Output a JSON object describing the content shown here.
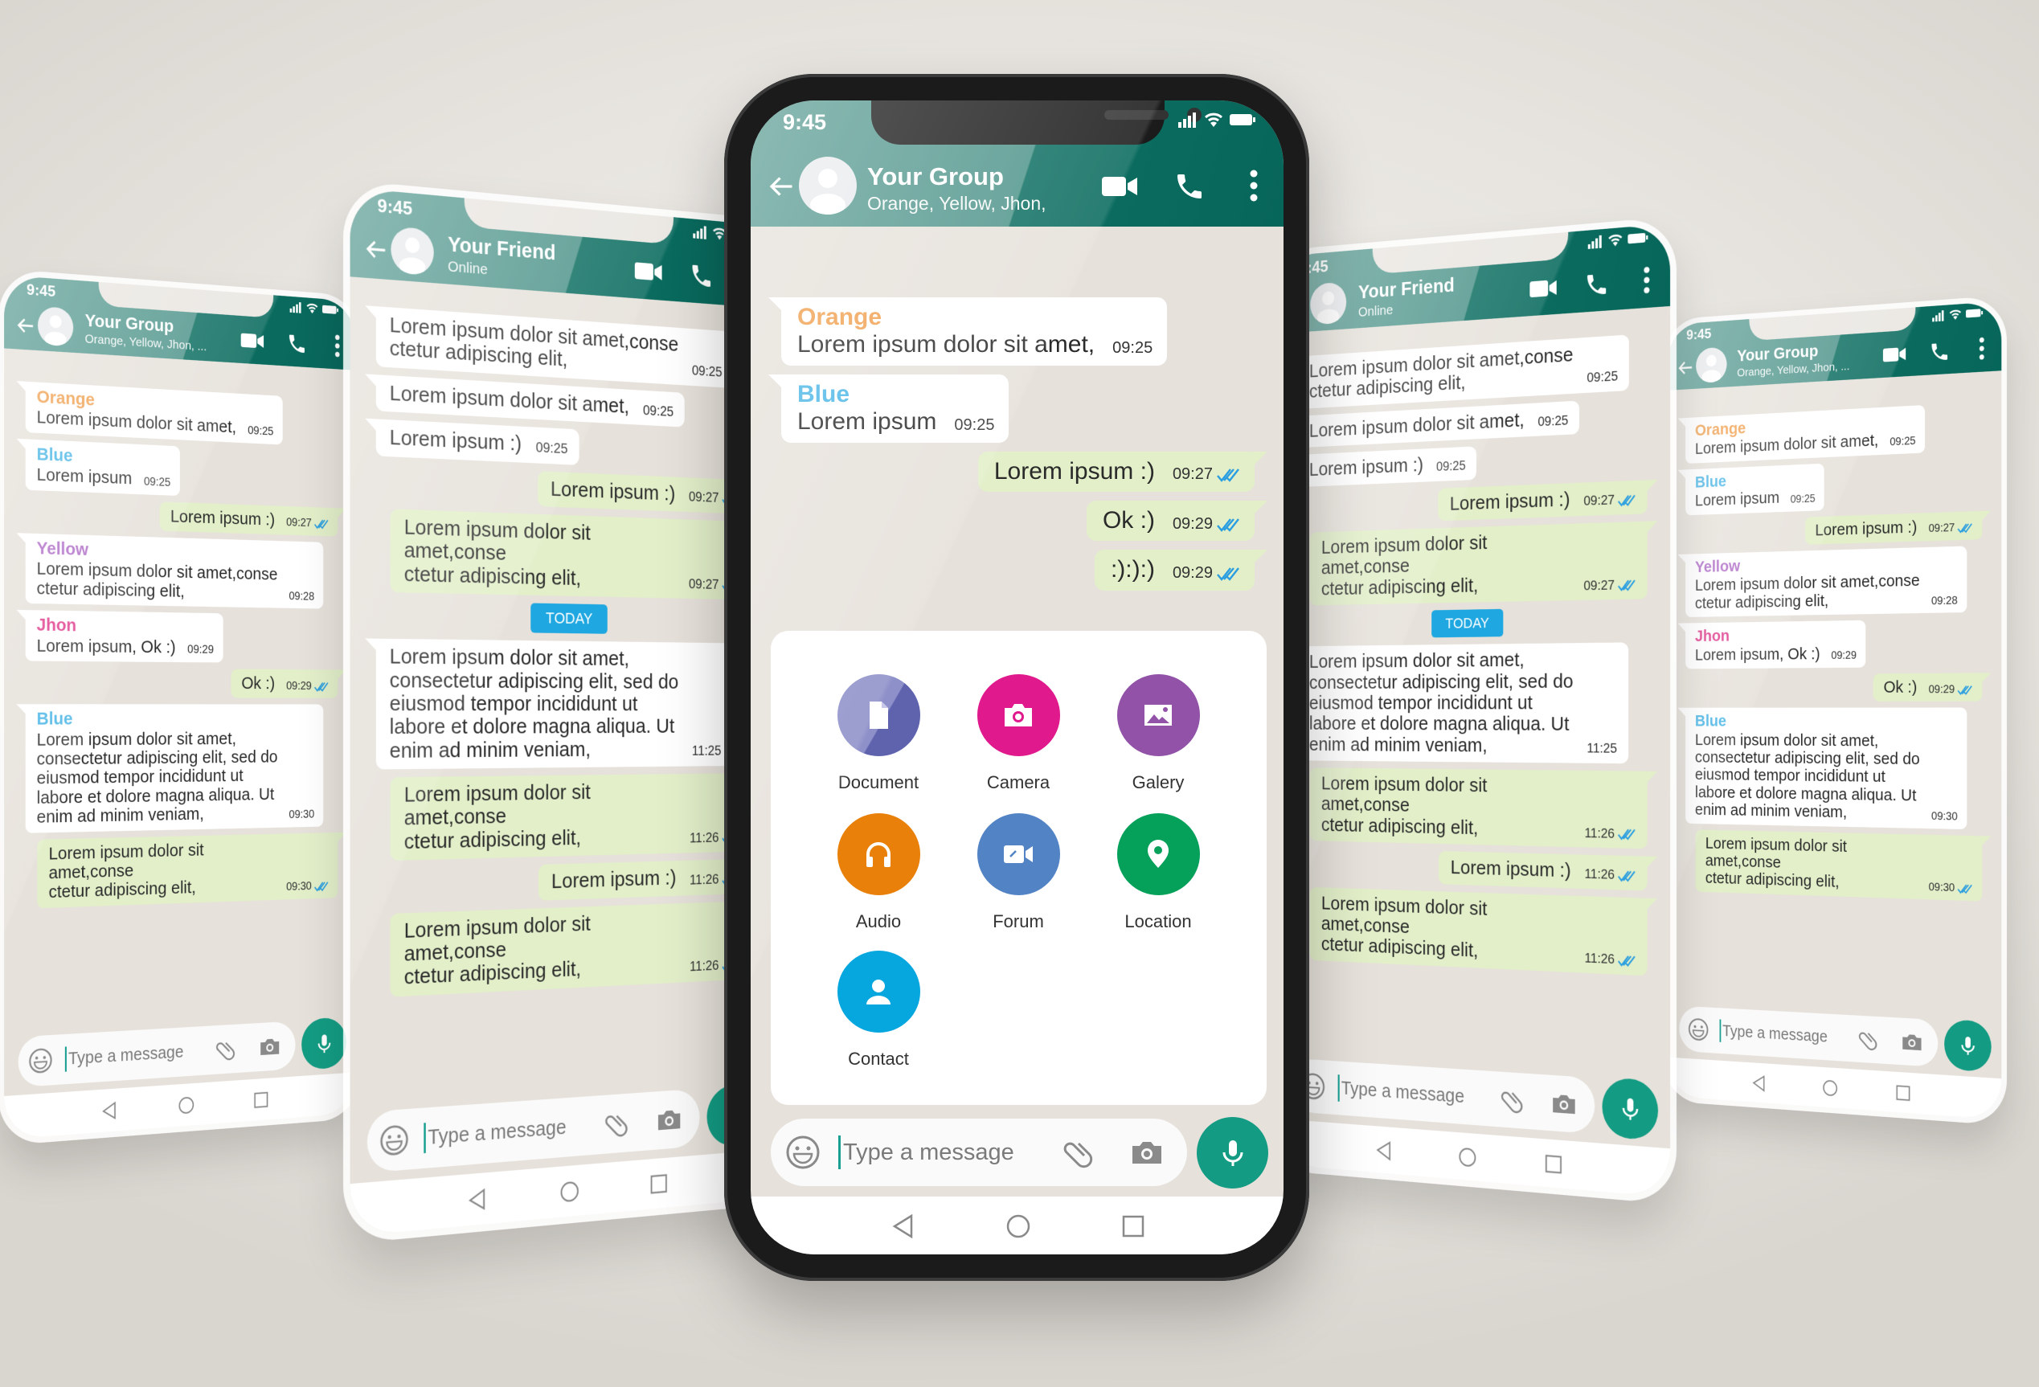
{
  "status_time": "9:45",
  "colors": {
    "header_teal": "#07665a",
    "header_teal_light": "#5f9f96",
    "chat_background": "#e6e1da",
    "outgoing_bubble": "#e2efc9",
    "incoming_bubble": "#ffffff",
    "read_ticks": "#2a9ee0",
    "today_badge": "#1ea7e0",
    "mic_button": "#139c83"
  },
  "input_placeholder": "Type a message",
  "center_phone": {
    "header": {
      "title": "Your Group",
      "subtitle": "Orange, Yellow, Jhon,"
    },
    "messages": [
      {
        "type": "in",
        "name": "Orange",
        "name_color": "#f0a04f",
        "text": "Lorem ipsum dolor sit amet,",
        "time": "09:25"
      },
      {
        "type": "in",
        "name": "Blue",
        "name_color": "#4bb6e6",
        "text": "Lorem ipsum",
        "time": "09:25"
      },
      {
        "type": "out",
        "text": "Lorem ipsum :)",
        "time": "09:27",
        "read": true
      },
      {
        "type": "out",
        "text": "Ok :)",
        "time": "09:29",
        "read": true
      },
      {
        "type": "out",
        "text": ":):):)",
        "time": "09:29",
        "read": true
      }
    ],
    "attach_menu": [
      {
        "label": "Document",
        "icon": "document",
        "color": "#8e90c9"
      },
      {
        "label": "Camera",
        "icon": "camera",
        "color": "#e0198c"
      },
      {
        "label": "Galery",
        "icon": "gallery",
        "color": "#9152a8"
      },
      {
        "label": "Audio",
        "icon": "headphones",
        "color": "#e8800a"
      },
      {
        "label": "Forum",
        "icon": "video-link",
        "color": "#5283c4"
      },
      {
        "label": "Location",
        "icon": "location-pin",
        "color": "#05a05a"
      },
      {
        "label": "Contact",
        "icon": "person",
        "color": "#06a6de"
      }
    ]
  },
  "side_phones": [
    {
      "position": "far-left",
      "header": {
        "title": "Your Group",
        "subtitle": "Orange, Yellow, Jhon, ..."
      },
      "conversation": "group"
    },
    {
      "position": "left",
      "header": {
        "title": "Your Friend",
        "subtitle": "Online"
      },
      "conversation": "friend"
    },
    {
      "position": "right",
      "header": {
        "title": "Your Friend",
        "subtitle": "Online"
      },
      "conversation": "friend"
    },
    {
      "position": "far-right",
      "header": {
        "title": "Your Group",
        "subtitle": "Orange, Yellow, Jhon, ..."
      },
      "conversation": "group"
    }
  ],
  "conversations": {
    "group": [
      {
        "type": "in",
        "name": "Orange",
        "name_color": "#f0a04f",
        "text": "Lorem ipsum dolor sit amet,",
        "time": "09:25"
      },
      {
        "type": "in",
        "name": "Blue",
        "name_color": "#4bb6e6",
        "text": "Lorem ipsum",
        "time": "09:25"
      },
      {
        "type": "out",
        "text": "Lorem ipsum :)",
        "time": "09:27",
        "read": true
      },
      {
        "type": "in",
        "name": "Yellow",
        "name_color": "#b06ec8",
        "text": "Lorem ipsum dolor sit amet,conse\nctetur adipiscing elit,",
        "time": "09:28"
      },
      {
        "type": "in",
        "name": "Jhon",
        "name_color": "#e0408f",
        "text": "Lorem ipsum, Ok :)",
        "time": "09:29"
      },
      {
        "type": "out",
        "text": "Ok :)",
        "time": "09:29",
        "read": true
      },
      {
        "type": "in",
        "name": "Blue",
        "name_color": "#4bb6e6",
        "text": "Lorem ipsum dolor sit amet,\nconsectetur adipiscing elit, sed do\neiusmod tempor incididunt ut\nlabore et dolore magna aliqua. Ut\nenim ad minim veniam,",
        "time": "09:30"
      },
      {
        "type": "out",
        "text": "Lorem ipsum dolor sit amet,conse\nctetur adipiscing elit,",
        "time": "09:30",
        "read": true
      }
    ],
    "friend": [
      {
        "type": "in",
        "text": "Lorem ipsum dolor sit amet,conse\nctetur adipiscing elit,",
        "time": "09:25"
      },
      {
        "type": "in",
        "text": "Lorem ipsum dolor sit amet,",
        "time": "09:25"
      },
      {
        "type": "in",
        "text": "Lorem ipsum :)",
        "time": "09:25"
      },
      {
        "type": "out",
        "text": "Lorem ipsum :)",
        "time": "09:27",
        "read": true
      },
      {
        "type": "out",
        "text": "Lorem ipsum dolor sit amet,conse\nctetur adipiscing elit,",
        "time": "09:27",
        "read": true
      },
      {
        "type": "date",
        "text": "TODAY"
      },
      {
        "type": "in",
        "text": "Lorem ipsum dolor sit amet,\nconsectetur adipiscing elit, sed do\neiusmod tempor incididunt ut\nlabore et dolore magna aliqua. Ut\nenim ad minim veniam,",
        "time": "11:25"
      },
      {
        "type": "out",
        "text": "Lorem ipsum dolor sit amet,conse\nctetur adipiscing elit,",
        "time": "11:26",
        "read": true
      },
      {
        "type": "out",
        "text": "Lorem ipsum :)",
        "time": "11:26",
        "read": true
      },
      {
        "type": "out",
        "text": "Lorem ipsum dolor sit amet,conse\nctetur adipiscing elit,",
        "time": "11:26",
        "read": true
      }
    ]
  }
}
